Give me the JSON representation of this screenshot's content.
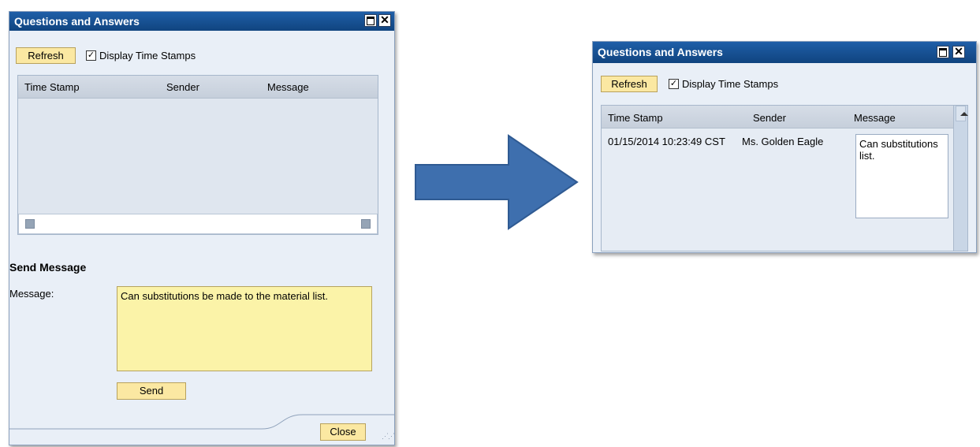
{
  "left_window": {
    "title": "Questions and Answers",
    "refresh_label": "Refresh",
    "display_timestamps_label": "Display Time Stamps",
    "display_timestamps_checked": true,
    "columns": [
      "Time Stamp",
      "Sender",
      "Message"
    ],
    "send_section_title": "Send Message",
    "message_label": "Message:",
    "message_value": "Can substitutions be made to the material list.",
    "send_label": "Send",
    "close_label": "Close"
  },
  "right_window": {
    "title": "Questions and Answers",
    "refresh_label": "Refresh",
    "display_timestamps_label": "Display Time Stamps",
    "display_timestamps_checked": true,
    "columns": [
      "Time Stamp",
      "Sender",
      "Message"
    ],
    "rows": [
      {
        "time_stamp": "01/15/2014 10:23:49 CST",
        "sender": "Ms. Golden Eagle",
        "message": "Can substitutions\nlist."
      }
    ]
  },
  "icons": {
    "maximize": "maximize-icon",
    "close": "close-icon",
    "arrow": "right-arrow-icon",
    "scroll_up": "scroll-up-icon"
  },
  "colors": {
    "titlebar": "#10447f",
    "window_bg": "#e9eff7",
    "button_bg": "#fbe8a2",
    "textarea_bg": "#fbf3a8",
    "arrow": "#3e6fae"
  }
}
